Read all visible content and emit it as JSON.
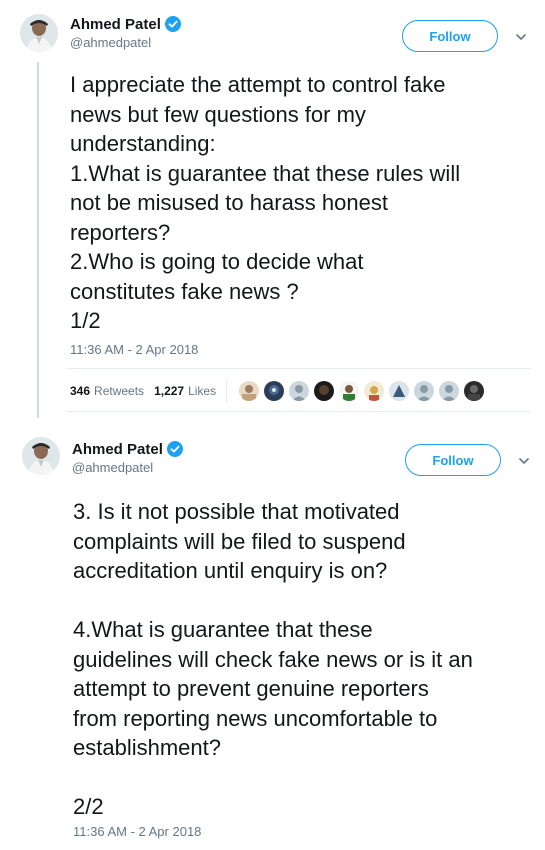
{
  "tweets": [
    {
      "author": {
        "display_name": "Ahmed Patel",
        "handle": "@ahmedpatel",
        "verified": true
      },
      "follow_label": "Follow",
      "text": "I appreciate the attempt to control fake\nnews but few questions for my\nunderstanding:\n1.What is guarantee that these rules will\nnot be misused to harass honest\nreporters?\n2.Who is going to decide what\nconstitutes fake news ?\n1/2",
      "timestamp": "11:36 AM - 2 Apr 2018",
      "retweets": {
        "count": "346",
        "label": "Retweets"
      },
      "likes": {
        "count": "1,227",
        "label": "Likes"
      }
    },
    {
      "author": {
        "display_name": "Ahmed Patel",
        "handle": "@ahmedpatel",
        "verified": true
      },
      "follow_label": "Follow",
      "text": "3. Is it not possible that motivated\ncomplaints will be filed to suspend\naccreditation until enquiry is on?\n\n4.What is guarantee that these\nguidelines will check fake news or is it an\nattempt to prevent genuine reporters\nfrom reporting news uncomfortable to\nestablishment?\n\n2/2",
      "timestamp": "11:36 AM - 2 Apr 2018"
    }
  ],
  "colors": {
    "accent": "#1da1f2",
    "text": "#14171a",
    "muted": "#657786",
    "border": "#e6ecf0"
  },
  "icons": [
    "verified-badge-icon",
    "chevron-down-icon",
    "avatar"
  ]
}
